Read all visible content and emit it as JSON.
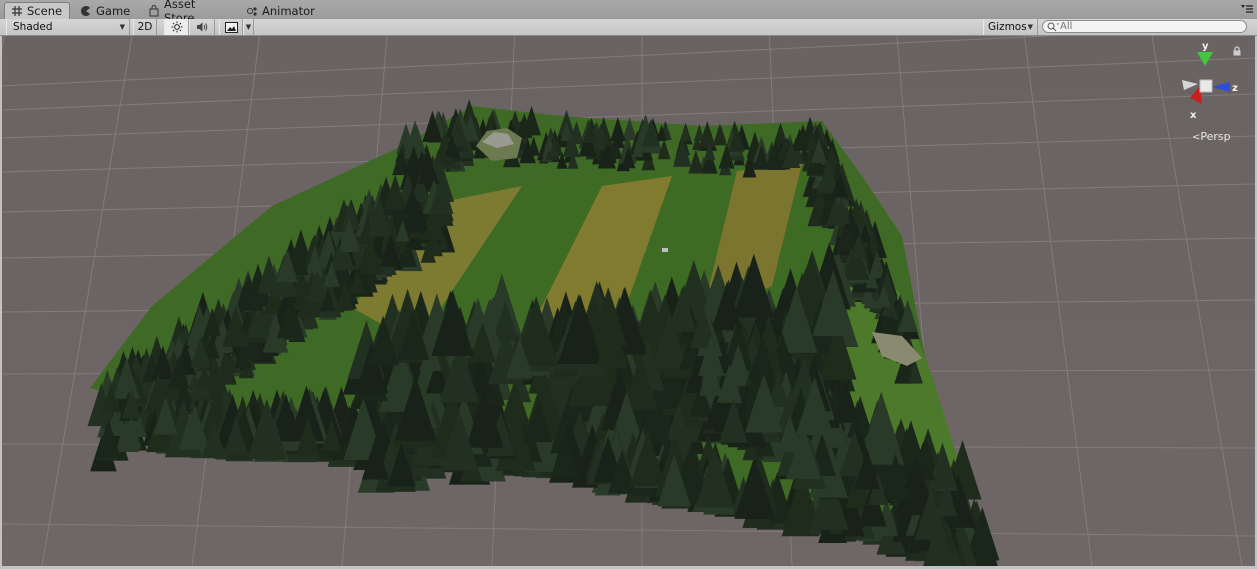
{
  "tabs": [
    {
      "label": "Scene",
      "icon": "scene-grid-icon",
      "active": true
    },
    {
      "label": "Game",
      "icon": "game-pacman-icon",
      "active": false
    },
    {
      "label": "Asset Store",
      "icon": "asset-store-bag-icon",
      "active": false
    },
    {
      "label": "Animator",
      "icon": "animator-icon",
      "active": false
    }
  ],
  "toolbar": {
    "draw_mode": "Shaded",
    "mode_2d": "2D",
    "gizmos_label": "Gizmos",
    "search_placeholder": "All"
  },
  "viewport": {
    "projection_label": "Persp",
    "gizmo_axes": {
      "y": "y",
      "z": "z",
      "x": "x"
    },
    "colors": {
      "background": "#6f6666",
      "grid": "#857c7c",
      "grass_dark": "#3e6b24",
      "grass_light": "#7f7a2c",
      "tree": "#1e2a1e",
      "axis_x": "#c81e1e",
      "axis_y": "#3ec83e",
      "axis_z": "#2c4fd8"
    }
  }
}
